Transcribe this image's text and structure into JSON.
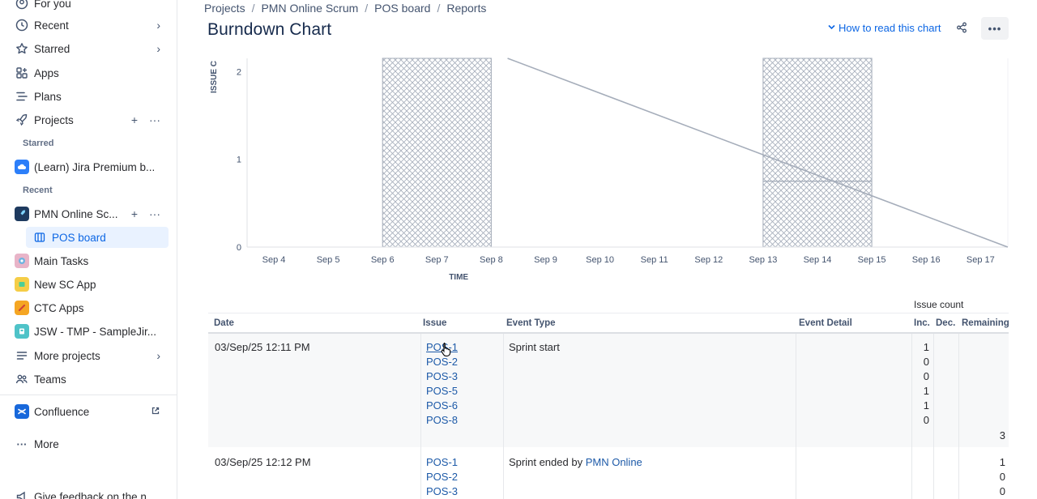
{
  "sidebar": {
    "items": [
      {
        "label": "For you",
        "icon": "user-circle-icon"
      },
      {
        "label": "Recent",
        "icon": "clock-icon"
      },
      {
        "label": "Starred",
        "icon": "star-icon"
      },
      {
        "label": "Apps",
        "icon": "apps-icon"
      },
      {
        "label": "Plans",
        "icon": "plans-icon"
      },
      {
        "label": "Projects",
        "icon": "rocket-icon"
      }
    ],
    "starred_heading": "Starred",
    "starred_projects": [
      {
        "label": "(Learn) Jira Premium b..."
      }
    ],
    "recent_heading": "Recent",
    "recent_projects": [
      {
        "label": "PMN Online Sc..."
      },
      {
        "label": "POS board"
      },
      {
        "label": "Main Tasks"
      },
      {
        "label": "New SC App"
      },
      {
        "label": "CTC Apps"
      },
      {
        "label": "JSW - TMP - SampleJir..."
      }
    ],
    "more_projects": "More projects",
    "teams": "Teams",
    "confluence": "Confluence",
    "more": "More",
    "feedback": "Give feedback on the n..."
  },
  "breadcrumb": [
    "Projects",
    "PMN Online Scrum",
    "POS board",
    "Reports"
  ],
  "page": {
    "title": "Burndown Chart",
    "how_to": "How to read this chart"
  },
  "chart_data": {
    "type": "line",
    "ylabel": "ISSUE C",
    "xlabel": "TIME",
    "x_ticks": [
      "Sep 4",
      "Sep 5",
      "Sep 6",
      "Sep 7",
      "Sep 8",
      "Sep 9",
      "Sep 10",
      "Sep 11",
      "Sep 12",
      "Sep 13",
      "Sep 14",
      "Sep 15",
      "Sep 16",
      "Sep 17"
    ],
    "y_ticks": [
      "0",
      "1",
      "2"
    ],
    "ylim": [
      0,
      2.15
    ],
    "guideline": {
      "from": [
        "Sep 8.3",
        2.15
      ],
      "to": [
        "Sep 17.5",
        0
      ]
    },
    "non_working_days": [
      [
        "Sep 6",
        "Sep 8"
      ],
      [
        "Sep 13",
        "Sep 15"
      ]
    ],
    "remaining_steps": [
      {
        "from": "Sep 13",
        "to": "Sep 15",
        "value": 0.75
      }
    ]
  },
  "table": {
    "group_header": "Issue count",
    "headers": {
      "date": "Date",
      "issue": "Issue",
      "event_type": "Event Type",
      "event_detail": "Event Detail",
      "inc": "Inc.",
      "dec": "Dec.",
      "remaining": "Remaining"
    },
    "rows": [
      {
        "date": "03/Sep/25 12:11 PM",
        "event_type": "Sprint start",
        "issues": [
          "POS-1",
          "POS-2",
          "POS-3",
          "POS-5",
          "POS-6",
          "POS-8"
        ],
        "inc": [
          "1",
          "0",
          "0",
          "1",
          "1",
          "0"
        ],
        "remaining": "3"
      },
      {
        "date": "03/Sep/25 12:12 PM",
        "event_type": "Sprint ended by",
        "event_user": "PMN Online",
        "issues": [
          "POS-1",
          "POS-2",
          "POS-3"
        ],
        "remaining_values": [
          "1",
          "0",
          "0"
        ]
      }
    ]
  }
}
